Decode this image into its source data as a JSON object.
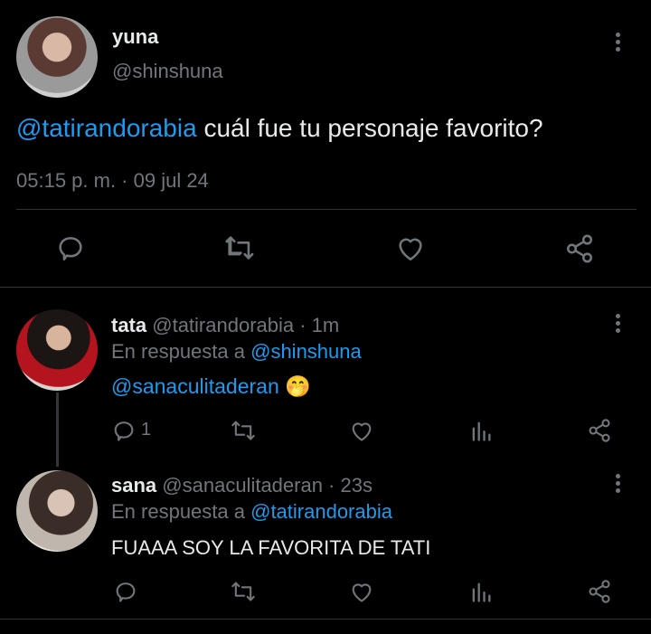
{
  "main_tweet": {
    "author_name": "yuna",
    "handle": "@shinshuna",
    "mention": "@tatirandorabia",
    "text": "cuál fue tu personaje favorito?",
    "timestamp": "05:15 p. m. · 09 jul 24"
  },
  "replies": [
    {
      "author_name": "tata",
      "handle_time": "@tatirandorabia · 1m",
      "reply_prefix": "En respuesta a",
      "reply_to": "@shinshuna",
      "mention": "@sanaculitaderan",
      "emoji": "🤭",
      "reply_count": "1"
    },
    {
      "author_name": "sana",
      "handle_time": "@sanaculitaderan · 23s",
      "reply_prefix": "En respuesta a",
      "reply_to": "@tatirandorabia",
      "text": "FUAAA SOY LA FAVORITA DE TATI"
    }
  ],
  "colors": {
    "background": "#000000",
    "text": "#e7e9ea",
    "muted": "#71767b",
    "accent": "#1d9bf0",
    "divider": "#2f3336"
  },
  "icons": [
    "reply-icon",
    "retweet-icon",
    "like-icon",
    "share-icon",
    "views-icon",
    "more-icon"
  ]
}
